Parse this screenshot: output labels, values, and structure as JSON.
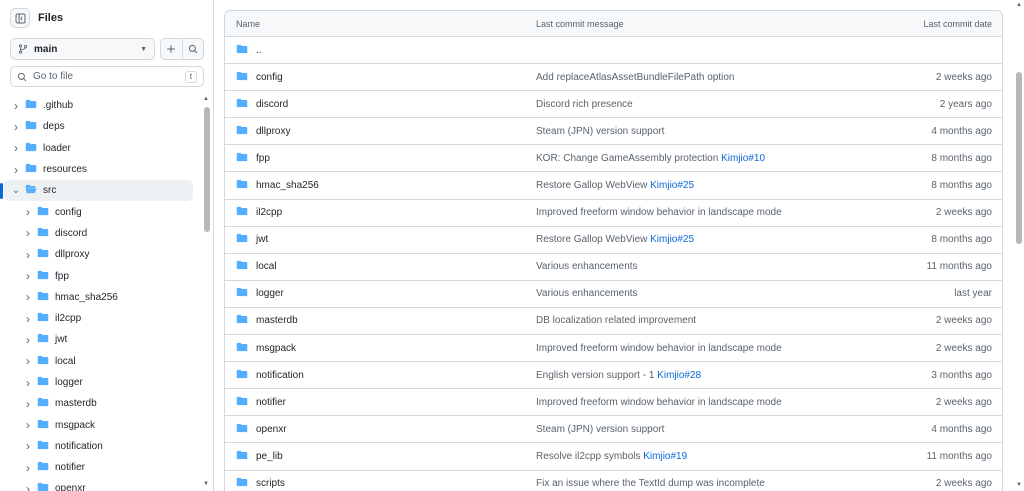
{
  "sidebar": {
    "title": "Files",
    "branch": "main",
    "goto_placeholder": "Go to file",
    "goto_shortcut": "t",
    "tree": [
      {
        "label": ".github",
        "depth": 0,
        "open": false,
        "selected": false
      },
      {
        "label": "deps",
        "depth": 0,
        "open": false,
        "selected": false
      },
      {
        "label": "loader",
        "depth": 0,
        "open": false,
        "selected": false
      },
      {
        "label": "resources",
        "depth": 0,
        "open": false,
        "selected": false
      },
      {
        "label": "src",
        "depth": 0,
        "open": true,
        "selected": true
      },
      {
        "label": "config",
        "depth": 1,
        "open": false,
        "selected": false
      },
      {
        "label": "discord",
        "depth": 1,
        "open": false,
        "selected": false
      },
      {
        "label": "dllproxy",
        "depth": 1,
        "open": false,
        "selected": false
      },
      {
        "label": "fpp",
        "depth": 1,
        "open": false,
        "selected": false
      },
      {
        "label": "hmac_sha256",
        "depth": 1,
        "open": false,
        "selected": false
      },
      {
        "label": "il2cpp",
        "depth": 1,
        "open": false,
        "selected": false
      },
      {
        "label": "jwt",
        "depth": 1,
        "open": false,
        "selected": false
      },
      {
        "label": "local",
        "depth": 1,
        "open": false,
        "selected": false
      },
      {
        "label": "logger",
        "depth": 1,
        "open": false,
        "selected": false
      },
      {
        "label": "masterdb",
        "depth": 1,
        "open": false,
        "selected": false
      },
      {
        "label": "msgpack",
        "depth": 1,
        "open": false,
        "selected": false
      },
      {
        "label": "notification",
        "depth": 1,
        "open": false,
        "selected": false
      },
      {
        "label": "notifier",
        "depth": 1,
        "open": false,
        "selected": false
      },
      {
        "label": "openxr",
        "depth": 1,
        "open": false,
        "selected": false
      }
    ]
  },
  "table": {
    "headers": {
      "name": "Name",
      "message": "Last commit message",
      "date": "Last commit date"
    },
    "rows": [
      {
        "name": "..",
        "message": "",
        "ref": "",
        "date": ""
      },
      {
        "name": "config",
        "message": "Add replaceAtlasAssetBundleFilePath option",
        "ref": "",
        "date": "2 weeks ago"
      },
      {
        "name": "discord",
        "message": "Discord rich presence",
        "ref": "",
        "date": "2 years ago"
      },
      {
        "name": "dllproxy",
        "message": "Steam (JPN) version support",
        "ref": "",
        "date": "4 months ago"
      },
      {
        "name": "fpp",
        "message": "KOR: Change GameAssembly protection ",
        "ref": "Kimjio#10",
        "date": "8 months ago"
      },
      {
        "name": "hmac_sha256",
        "message": "Restore Gallop WebView ",
        "ref": "Kimjio#25",
        "date": "8 months ago"
      },
      {
        "name": "il2cpp",
        "message": "Improved freeform window behavior in landscape mode",
        "ref": "",
        "date": "2 weeks ago"
      },
      {
        "name": "jwt",
        "message": "Restore Gallop WebView ",
        "ref": "Kimjio#25",
        "date": "8 months ago"
      },
      {
        "name": "local",
        "message": "Various enhancements",
        "ref": "",
        "date": "11 months ago"
      },
      {
        "name": "logger",
        "message": "Various enhancements",
        "ref": "",
        "date": "last year"
      },
      {
        "name": "masterdb",
        "message": "DB localization related improvement",
        "ref": "",
        "date": "2 weeks ago"
      },
      {
        "name": "msgpack",
        "message": "Improved freeform window behavior in landscape mode",
        "ref": "",
        "date": "2 weeks ago"
      },
      {
        "name": "notification",
        "message": "English version support - 1 ",
        "ref": "Kimjio#28",
        "date": "3 months ago"
      },
      {
        "name": "notifier",
        "message": "Improved freeform window behavior in landscape mode",
        "ref": "",
        "date": "2 weeks ago"
      },
      {
        "name": "openxr",
        "message": "Steam (JPN) version support",
        "ref": "",
        "date": "4 months ago"
      },
      {
        "name": "pe_lib",
        "message": "Resolve il2cpp symbols ",
        "ref": "Kimjio#19",
        "date": "11 months ago"
      },
      {
        "name": "scripts",
        "message": "Fix an issue where the TextId dump was incomplete",
        "ref": "",
        "date": "2 weeks ago"
      }
    ]
  },
  "colors": {
    "folder": "#54aeff",
    "link": "#0969da",
    "accent": "#0969da",
    "muted": "#59636e",
    "border": "#d1d9e0"
  },
  "icons": [
    "sidebar-collapse-icon",
    "git-branch-icon",
    "chevron-down-icon",
    "plus-icon",
    "search-icon",
    "chevron-right-icon",
    "folder-icon",
    "folder-open-icon"
  ]
}
